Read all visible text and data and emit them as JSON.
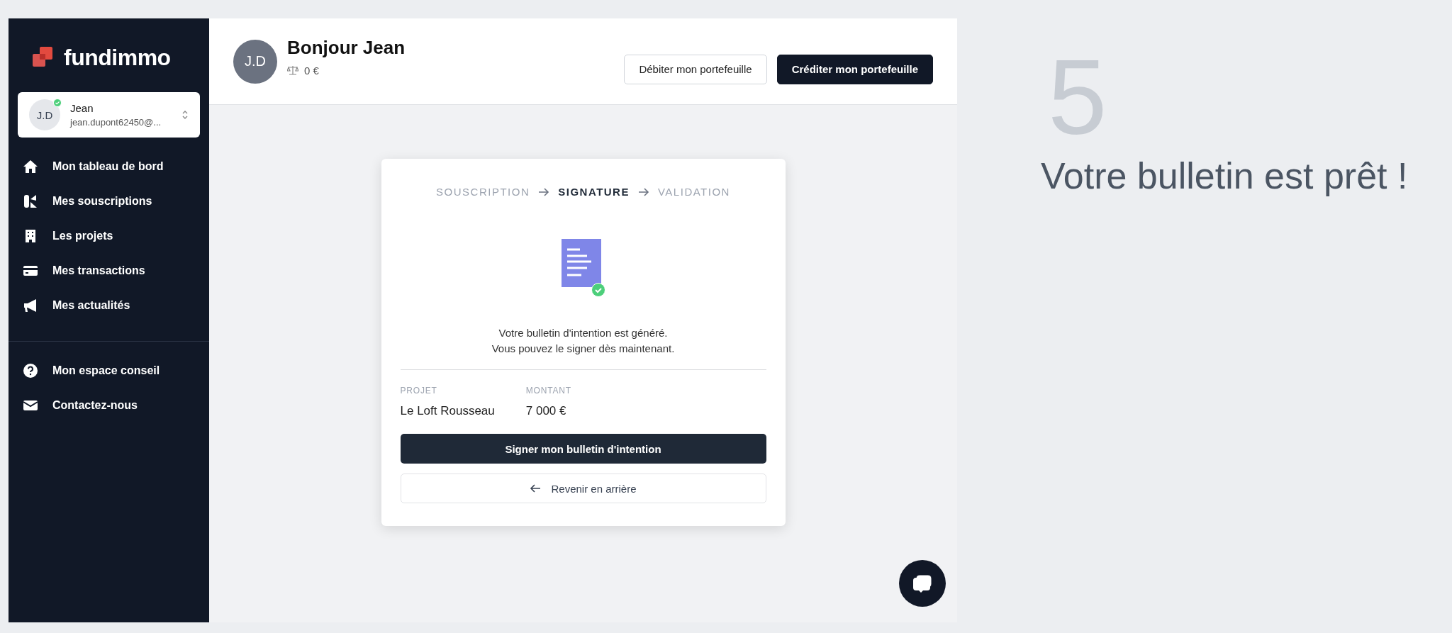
{
  "sidebar": {
    "logo": "fundimmo",
    "account": {
      "initials": "J.D",
      "name": "Jean",
      "email": "jean.dupont62450@..."
    },
    "nav": [
      {
        "label": "Mon tableau de bord"
      },
      {
        "label": "Mes souscriptions"
      },
      {
        "label": "Les projets"
      },
      {
        "label": "Mes transactions"
      },
      {
        "label": "Mes actualités"
      }
    ],
    "secondary_nav": [
      {
        "label": "Mon espace conseil"
      },
      {
        "label": "Contactez-nous"
      }
    ]
  },
  "header": {
    "initials": "J.D",
    "greeting": "Bonjour Jean",
    "balance": "0 €",
    "buttons": [
      {
        "label": "Débiter mon portefeuille",
        "kind": "secondary"
      },
      {
        "label": "Créditer mon portefeuille",
        "kind": "primary"
      }
    ]
  },
  "card": {
    "steps": [
      {
        "label": "SOUSCRIPTION",
        "selected": false
      },
      {
        "label": "SIGNATURE",
        "selected": true
      },
      {
        "label": "VALIDATION",
        "selected": false
      }
    ],
    "message": [
      "Votre bulletin d'intention est généré.",
      "Vous pouvez le signer dès maintenant."
    ],
    "fields": [
      {
        "label": "PROJET",
        "value": "Le Loft Rousseau"
      },
      {
        "label": "MONTANT",
        "value": "7 000 €"
      }
    ],
    "primary_button": "Signer mon bulletin d'intention",
    "back_button": "Revenir en arrière"
  },
  "caption": {
    "step_number": "5",
    "title": "Votre bulletin est prêt !"
  }
}
